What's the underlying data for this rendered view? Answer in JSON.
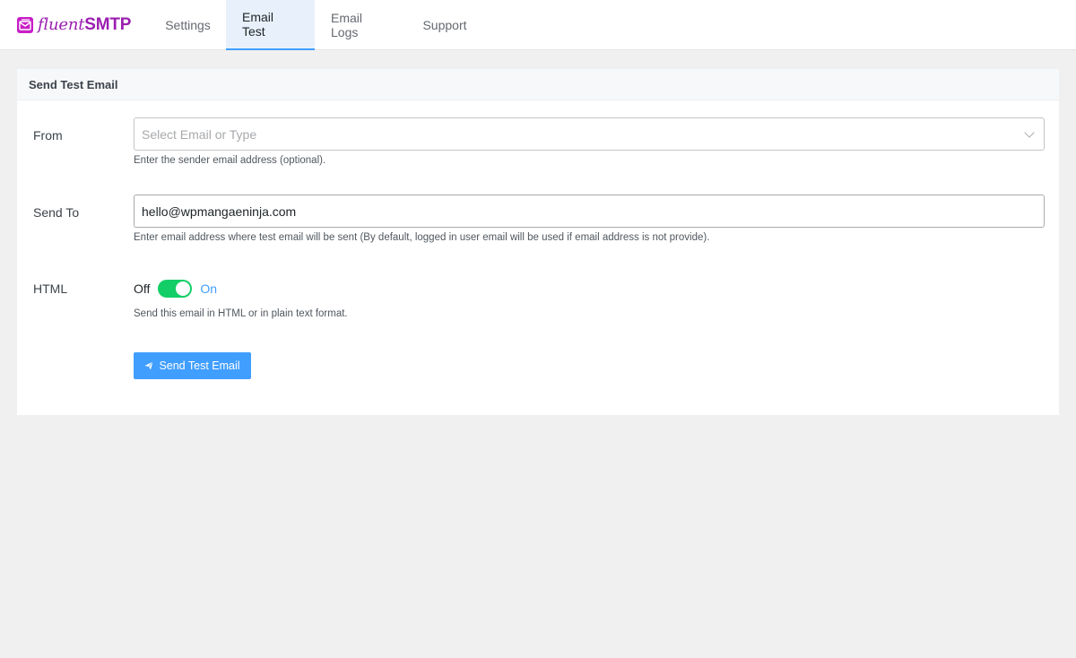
{
  "brand": {
    "name_part1": "fluent",
    "name_part2": "SMTP",
    "icon": "envelope-logo-icon",
    "color": "#9b1fb0"
  },
  "nav": {
    "tabs": [
      {
        "label": "Settings",
        "active": false
      },
      {
        "label": "Email Test",
        "active": true
      },
      {
        "label": "Email Logs",
        "active": false
      },
      {
        "label": "Support",
        "active": false
      }
    ]
  },
  "card": {
    "title": "Send Test Email"
  },
  "form": {
    "from": {
      "label": "From",
      "placeholder": "Select Email or Type",
      "help": "Enter the sender email address (optional).",
      "icon": "chevron-down-icon"
    },
    "send_to": {
      "label": "Send To",
      "value": "hello@wpmangaeninja.com",
      "help": "Enter email address where test email will be sent (By default, logged in user email will be used if email address is not provide)."
    },
    "html": {
      "label": "HTML",
      "off_label": "Off",
      "on_label": "On",
      "enabled": true,
      "help": "Send this email in HTML or in plain text format."
    },
    "submit": {
      "label": "Send Test Email",
      "icon": "paper-plane-icon"
    }
  },
  "colors": {
    "accent": "#409eff",
    "switch_on": "#13ce66",
    "brand": "#9b1fb0"
  }
}
